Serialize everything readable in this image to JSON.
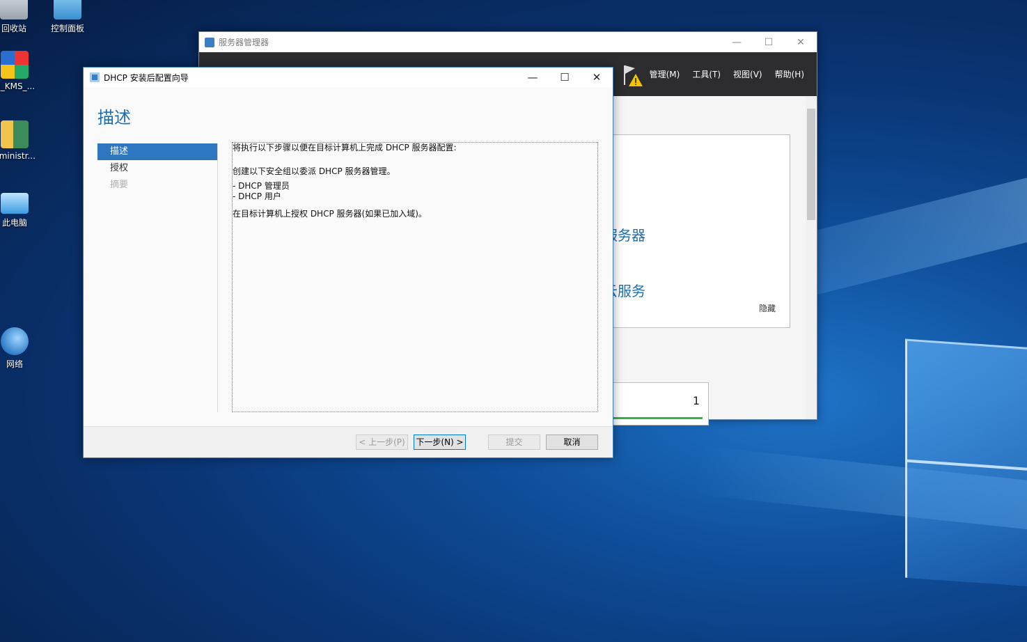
{
  "desktop": {
    "icons": [
      {
        "label": "回收站"
      },
      {
        "label": "控制面板"
      },
      {
        "label": "U_KMS_..."
      },
      {
        "label": "dministr..."
      },
      {
        "label": "此电脑"
      },
      {
        "label": "网络"
      }
    ]
  },
  "server_manager": {
    "title": "服务器管理器",
    "menu": [
      "管理(M)",
      "工具(T)",
      "视图(V)",
      "帮助(H)"
    ],
    "panel_texts": [
      "器",
      "也服务器",
      "到云服务"
    ],
    "hide_link": "隐藏",
    "tile_count": "1"
  },
  "wizard": {
    "title": "DHCP 安装后配置向导",
    "page_title": "描述",
    "nav": [
      {
        "label": "描述",
        "state": "active"
      },
      {
        "label": "授权",
        "state": "normal"
      },
      {
        "label": "摘要",
        "state": "disabled"
      }
    ],
    "description": {
      "intro": "将执行以下步骤以便在目标计算机上完成 DHCP 服务器配置:",
      "groups_line": "创建以下安全组以委派 DHCP 服务器管理。",
      "group1": "- DHCP 管理员",
      "group2": "- DHCP 用户",
      "authorize_line": "在目标计算机上授权 DHCP 服务器(如果已加入域)。"
    },
    "buttons": {
      "back": "< 上一步(P)",
      "next": "下一步(N) >",
      "commit": "提交",
      "cancel": "取消"
    }
  }
}
